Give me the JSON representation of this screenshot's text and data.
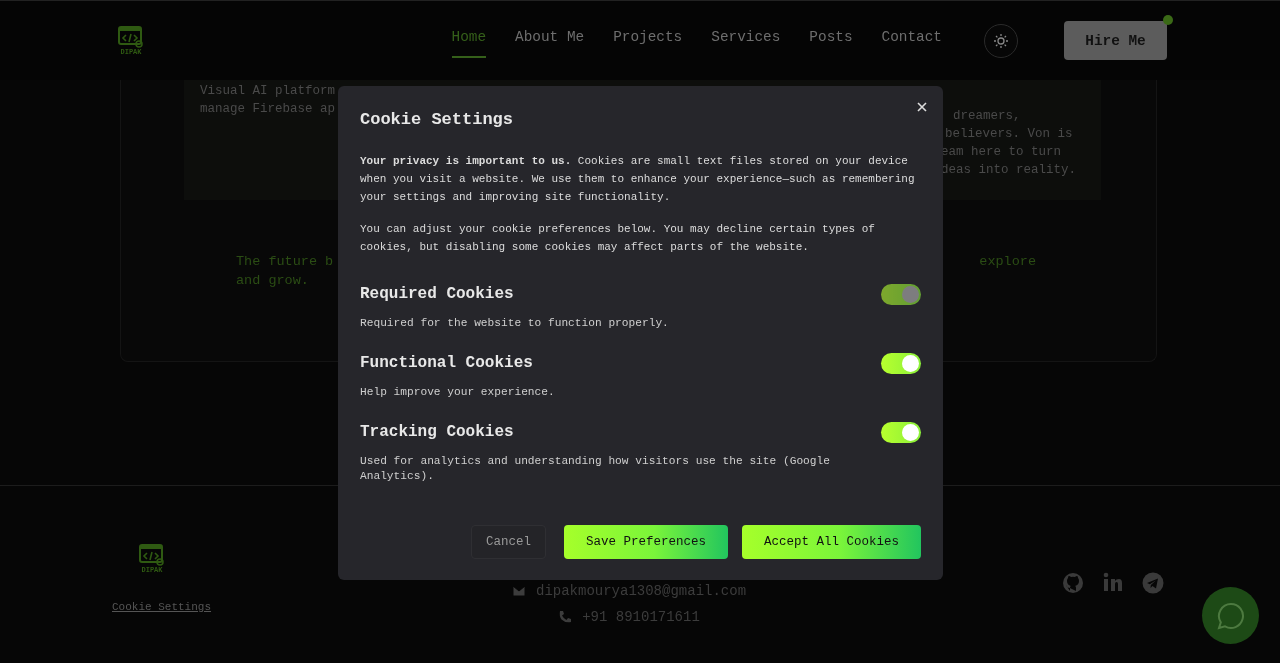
{
  "header": {
    "logo_text": "DIPAK",
    "nav": [
      {
        "label": "Home",
        "selected": true
      },
      {
        "label": "About Me",
        "selected": false
      },
      {
        "label": "Projects",
        "selected": false
      },
      {
        "label": "Services",
        "selected": false
      },
      {
        "label": "Posts",
        "selected": false
      },
      {
        "label": "Contact",
        "selected": false
      }
    ],
    "hire_button": "Hire Me"
  },
  "background": {
    "project_lines": [
      "Visual AI platform",
      "manage Firebase ap"
    ],
    "about_lines": [
      "dreamers,",
      "believers. Von is",
      "eam here to turn",
      "deas into reality."
    ],
    "tagline_start": "The future b",
    "tagline_end": "explore",
    "tagline_line2": "and grow."
  },
  "footer": {
    "logo_text": "DIPAK",
    "cookie_link": "Cookie Settings",
    "email": "dipakmourya1308@gmail.com",
    "phone": "+91 8910171611"
  },
  "cookie_dialog": {
    "title": "Cookie Settings",
    "intro": "**Your privacy is important to us.** Cookies are small text files stored on your device when you visit a website. We use them to enhance your experience—such as remembering your settings and improving site functionality.",
    "note": "You can adjust your cookie preferences below. You may decline certain types of cookies, but disabling some cookies may affect parts of the website.",
    "categories": [
      {
        "title": "Required Cookies",
        "description": "Required for the website to function properly.",
        "on": true,
        "disabled": true
      },
      {
        "title": "Functional Cookies",
        "description": "Help improve your experience.",
        "on": true,
        "disabled": false
      },
      {
        "title": "Tracking Cookies",
        "description": "Used for analytics and understanding how visitors use the site (Google Analytics).",
        "on": true,
        "disabled": false
      }
    ],
    "buttons": [
      {
        "label": "Cancel",
        "kind": "secondary"
      },
      {
        "label": "Save Preferences",
        "kind": "primary"
      },
      {
        "label": "Accept All Cookies",
        "kind": "primary"
      }
    ]
  }
}
